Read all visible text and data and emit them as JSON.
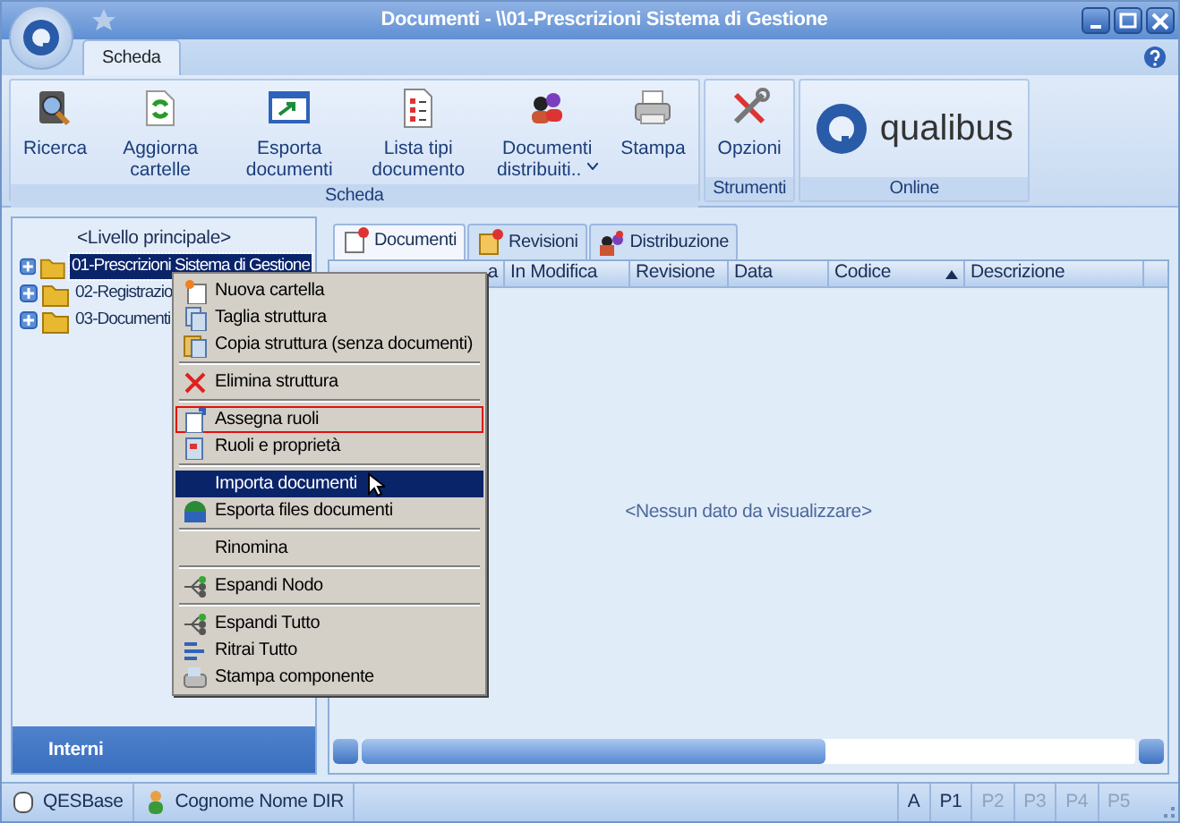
{
  "window": {
    "title": "Documenti - \\\\01-Prescrizioni Sistema di Gestione"
  },
  "ribbon_tabs": [
    {
      "label": "Scheda",
      "selected": true
    }
  ],
  "ribbon_groups": [
    {
      "label": "Scheda",
      "buttons": [
        {
          "label": "Ricerca"
        },
        {
          "label": "Aggiorna cartelle"
        },
        {
          "label": "Esporta documenti"
        },
        {
          "label": "Lista tipi documento"
        },
        {
          "label": "Documenti distribuiti..",
          "dropdown": true
        },
        {
          "label": "Stampa"
        }
      ]
    },
    {
      "label": "Strumenti",
      "buttons": [
        {
          "label": "Opzioni"
        }
      ]
    },
    {
      "label": "Online",
      "logo": "qualibus"
    }
  ],
  "tree": {
    "root": "<Livello principale>",
    "items": [
      {
        "label": "01-Prescrizioni Sistema di Gestione",
        "selected": true
      },
      {
        "label": "02-Registrazio",
        "selected": false
      },
      {
        "label": "03-Documenti",
        "selected": false
      }
    ]
  },
  "sidebar_footer": "Interni",
  "content_tabs": [
    {
      "label": "Documenti",
      "selected": true
    },
    {
      "label": "Revisioni",
      "selected": false
    },
    {
      "label": "Distribuzione",
      "selected": false
    }
  ],
  "table": {
    "columns": [
      {
        "label": "a",
        "sorted": false
      },
      {
        "label": "In Modifica",
        "sorted": false
      },
      {
        "label": "Revisione",
        "sorted": false
      },
      {
        "label": "Data",
        "sorted": false
      },
      {
        "label": "Codice",
        "sorted": true
      },
      {
        "label": "Descrizione",
        "sorted": false
      }
    ],
    "empty_text": "<Nessun dato da visualizzare>"
  },
  "context_menu": [
    {
      "kind": "item",
      "label": "Nuova cartella",
      "selected": false,
      "outlined": false
    },
    {
      "kind": "item",
      "label": "Taglia struttura",
      "selected": false,
      "outlined": false
    },
    {
      "kind": "item",
      "label": "Copia struttura (senza documenti)",
      "selected": false,
      "outlined": false
    },
    {
      "kind": "separator"
    },
    {
      "kind": "item",
      "label": "Elimina struttura",
      "selected": false,
      "outlined": false
    },
    {
      "kind": "separator"
    },
    {
      "kind": "item",
      "label": "Assegna ruoli",
      "selected": false,
      "outlined": true
    },
    {
      "kind": "item",
      "label": "Ruoli e proprietà",
      "selected": false,
      "outlined": false
    },
    {
      "kind": "separator"
    },
    {
      "kind": "item",
      "label": "Importa documenti",
      "selected": true,
      "outlined": false
    },
    {
      "kind": "item",
      "label": "Esporta files documenti",
      "selected": false,
      "outlined": false
    },
    {
      "kind": "separator"
    },
    {
      "kind": "item",
      "label": "Rinomina",
      "selected": false,
      "outlined": false
    },
    {
      "kind": "separator"
    },
    {
      "kind": "item",
      "label": "Espandi Nodo",
      "selected": false,
      "outlined": false
    },
    {
      "kind": "separator"
    },
    {
      "kind": "item",
      "label": "Espandi Tutto",
      "selected": false,
      "outlined": false
    },
    {
      "kind": "item",
      "label": "Ritrai Tutto",
      "selected": false,
      "outlined": false
    },
    {
      "kind": "item",
      "label": "Stampa componente",
      "selected": false,
      "outlined": false
    }
  ],
  "status_bar": {
    "left": [
      {
        "label": "QESBase"
      },
      {
        "label": "Cognome Nome DIR"
      }
    ],
    "right": [
      {
        "label": "A",
        "disabled": false
      },
      {
        "label": "P1",
        "disabled": false
      },
      {
        "label": "P2",
        "disabled": true
      },
      {
        "label": "P3",
        "disabled": true
      },
      {
        "label": "P4",
        "disabled": true
      },
      {
        "label": "P5",
        "disabled": true
      }
    ]
  }
}
